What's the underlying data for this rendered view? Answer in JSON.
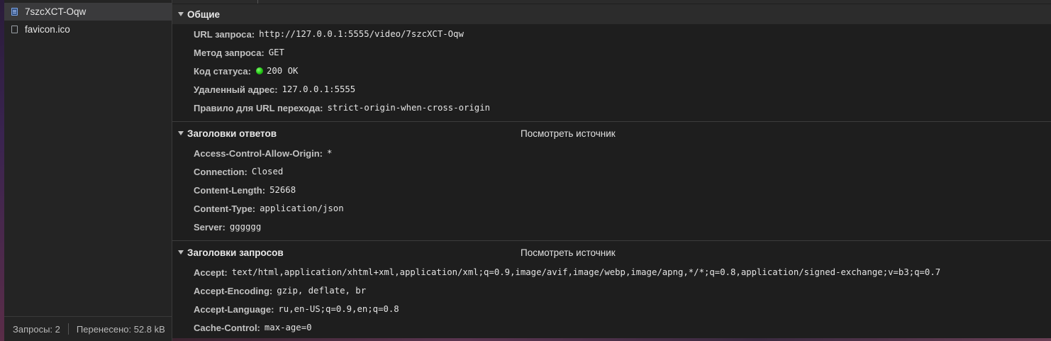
{
  "requests": {
    "items": [
      {
        "name": "7szcXCT-Oqw",
        "icon": "document-icon",
        "selected": true
      },
      {
        "name": "favicon.ico",
        "icon": "file-icon",
        "selected": false
      }
    ],
    "footer": {
      "count": "Запросы: 2",
      "transferred": "Перенесено: 52.8 kB"
    }
  },
  "general": {
    "title": "Общие",
    "rows": [
      {
        "key": "URL запроса:",
        "value": "http://127.0.0.1:5555/video/7szcXCT-Oqw"
      },
      {
        "key": "Метод запроса:",
        "value": "GET"
      },
      {
        "key": "Код статуса:",
        "value": "200 OK",
        "status_color": "#22c414"
      },
      {
        "key": "Удаленный адрес:",
        "value": "127.0.0.1:5555"
      },
      {
        "key": "Правило для URL перехода:",
        "value": "strict-origin-when-cross-origin"
      }
    ]
  },
  "response_headers": {
    "title": "Заголовки ответов",
    "view_source": "Посмотреть источник",
    "rows": [
      {
        "key": "Access-Control-Allow-Origin:",
        "value": "*"
      },
      {
        "key": "Connection:",
        "value": "Closed"
      },
      {
        "key": "Content-Length:",
        "value": "52668"
      },
      {
        "key": "Content-Type:",
        "value": "application/json"
      },
      {
        "key": "Server:",
        "value": "gggggg"
      }
    ]
  },
  "request_headers": {
    "title": "Заголовки запросов",
    "view_source": "Посмотреть источник",
    "rows": [
      {
        "key": "Accept:",
        "value": "text/html,application/xhtml+xml,application/xml;q=0.9,image/avif,image/webp,image/apng,*/*;q=0.8,application/signed-exchange;v=b3;q=0.7"
      },
      {
        "key": "Accept-Encoding:",
        "value": "gzip, deflate, br"
      },
      {
        "key": "Accept-Language:",
        "value": "ru,en-US;q=0.9,en;q=0.8"
      },
      {
        "key": "Cache-Control:",
        "value": "max-age=0"
      }
    ]
  }
}
